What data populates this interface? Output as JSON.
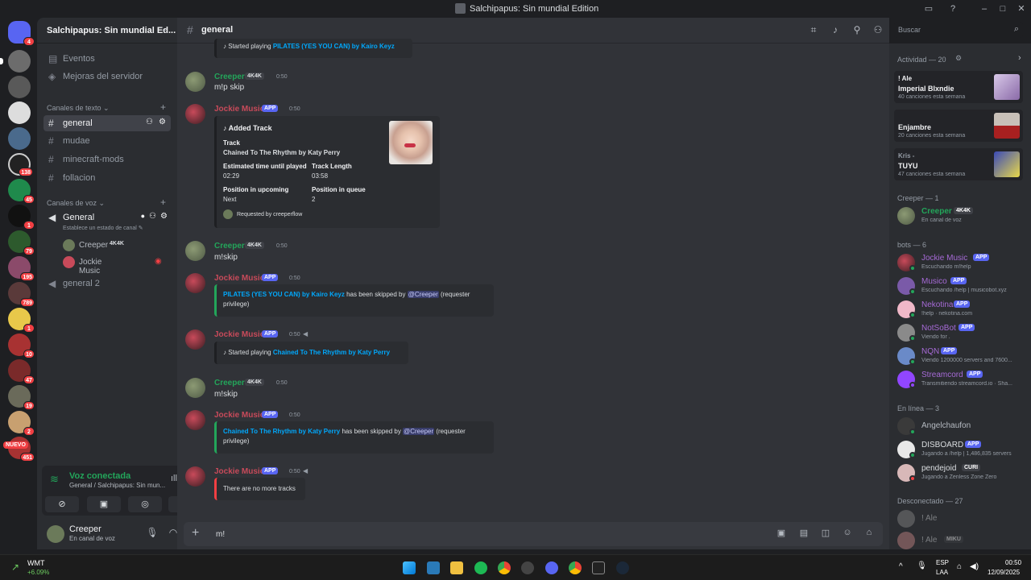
{
  "window": {
    "title": "Salchipapus: Sin mundial Edition"
  },
  "rail": {
    "badges": [
      "4",
      "138",
      "45",
      "1",
      "79",
      "195",
      "789",
      "1",
      "10",
      "47",
      "19",
      "2",
      "451"
    ],
    "new_label": "NUEVO"
  },
  "sidebar": {
    "server_name": "Salchipapus: Sin mundial Ed...",
    "events": "Eventos",
    "boost": "Mejoras del servidor",
    "text_category": "Canales de texto",
    "text_channels": [
      "general",
      "mudae",
      "minecraft-mods",
      "follacion"
    ],
    "voice_category": "Canales de voz",
    "voice_channel": "General",
    "voice_status_hint": "Establece un estado de canal",
    "voice_users": [
      {
        "name": "Creeper",
        "tag": "4K4K"
      },
      {
        "name": "Jockie Music"
      }
    ],
    "voice_channel_2": "general 2"
  },
  "voice_panel": {
    "status": "Voz conectada",
    "sub": "General / Salchipapus: Sin mun..."
  },
  "user_panel": {
    "name": "Creeper",
    "status": "En canal de voz"
  },
  "channel": {
    "name": "general"
  },
  "search": {
    "placeholder": "Buscar"
  },
  "messages": {
    "m0": {
      "prefix": "Started playing",
      "link": "PILATES (YES YOU CAN) by Kairo Keyz"
    },
    "m1": {
      "author": "Creeper",
      "tag": "4K4K",
      "time": "0:50",
      "text": "m!p skip"
    },
    "m2": {
      "author": "Jockie Music",
      "tag": "APP",
      "time": "0:50",
      "embed_title": "Added Track",
      "track_label": "Track",
      "track_value": "Chained To The Rhythm by Katy Perry",
      "est_label": "Estimated time until played",
      "est_value": "02:29",
      "len_label": "Track Length",
      "len_value": "03:58",
      "pos_up_label": "Position in upcoming",
      "pos_up_value": "Next",
      "pos_q_label": "Position in queue",
      "pos_q_value": "2",
      "footer": "Requested by creeperflow"
    },
    "m3": {
      "author": "Creeper",
      "tag": "4K4K",
      "time": "0:50",
      "text": "m!skip"
    },
    "m4": {
      "author": "Jockie Music",
      "tag": "APP",
      "time": "0:50",
      "link": "PILATES (YES YOU CAN) by Kairo Keyz",
      "middle": "has been skipped by",
      "mention": "@Creeper",
      "suffix": "(requester",
      "suffix2": "privilege)"
    },
    "m5": {
      "author": "Jockie Music",
      "tag": "APP",
      "time": "0:50",
      "prefix": "Started playing",
      "link": "Chained To The Rhythm by Katy Perry"
    },
    "m6": {
      "author": "Creeper",
      "tag": "4K4K",
      "time": "0:50",
      "text": "m!skip"
    },
    "m7": {
      "author": "Jockie Music",
      "tag": "APP",
      "time": "0:50",
      "link": "Chained To The Rhythm by Katy Perry",
      "middle": "has been skipped by",
      "mention": "@Creeper",
      "suffix": "(requester",
      "suffix2": "privilege)"
    },
    "m8": {
      "author": "Jockie Music",
      "tag": "APP",
      "time": "0:50",
      "text": "There are no more tracks"
    }
  },
  "composer": {
    "value": "m!"
  },
  "members": {
    "activity_header": "Actividad — 20",
    "activities": [
      {
        "n1": "! Ale",
        "n2": "Imperial Blxndie",
        "n3": "40 canciones esta semana"
      },
      {
        "n1": "",
        "n2": "Enjambre",
        "n3": "20 canciones esta semana"
      },
      {
        "n1": "Kris -",
        "n2": "TUYU",
        "n3": "47 canciones esta semana"
      }
    ],
    "creeper_header": "Creeper — 1",
    "creeper": {
      "name": "Creeper",
      "tag": "4K4K",
      "status": "En canal de voz"
    },
    "bots_header": "bots — 6",
    "bots": [
      {
        "name": "Jockie Music",
        "tag": "APP",
        "status": "Escuchando m!help"
      },
      {
        "name": "Musico",
        "tag": "APP",
        "status": "Escuchando /help | musicobot.xyz"
      },
      {
        "name": "Nekotina",
        "tag": "APP",
        "status": "!help · nekotina.com"
      },
      {
        "name": "NotSoBot",
        "tag": "APP",
        "status": "Viendo for ."
      },
      {
        "name": "NQN",
        "tag": "APP",
        "status": "Viendo 1200000 servers and 7600..."
      },
      {
        "name": "Streamcord",
        "tag": "APP",
        "status": "Transmitiendo streamcord.io · Sha..."
      }
    ],
    "online_header": "En línea — 3",
    "online": [
      {
        "name": "Angelchaufon",
        "status": ""
      },
      {
        "name": "DISBOARD",
        "tag": "APP",
        "status": "Jugando a /help | 1,486,835 servers"
      },
      {
        "name": "pendejoid",
        "tag": "CURI",
        "status": "Jugando a Zenless Zone Zero"
      }
    ],
    "offline_header": "Desconectado — 27",
    "offline": [
      {
        "name": "! Ale"
      },
      {
        "name": "! Ale",
        "tag": "MIKU"
      }
    ]
  },
  "taskbar": {
    "weather_name": "WMT",
    "weather_change": "+6.09%",
    "lang1": "ESP",
    "lang2": "LAA",
    "time": "00:50",
    "date": "12/09/2025"
  },
  "colors": {
    "green": "#23a55a",
    "jockie": "#c84a5a",
    "bot_purple": "#a66ad6",
    "link": "#00a8fc",
    "accent": "#5865f2"
  }
}
